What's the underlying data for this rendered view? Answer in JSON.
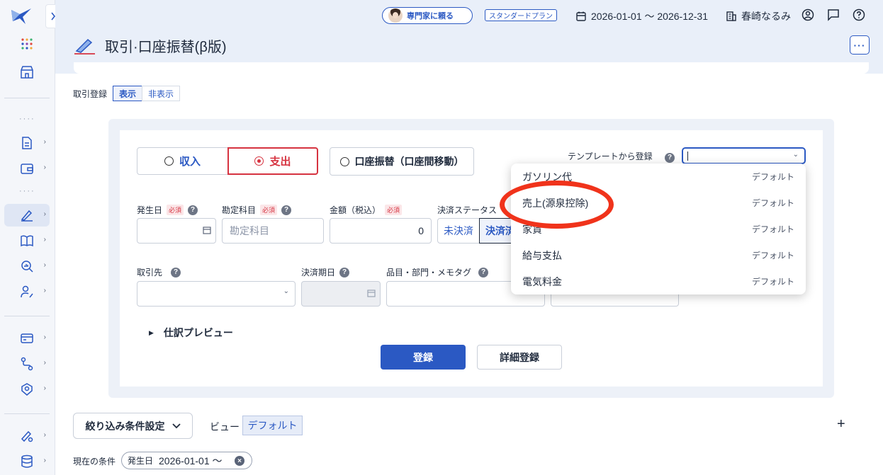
{
  "header": {
    "expert_button": "専門家に頼る",
    "plan": "スタンダードプラン",
    "period": "2026-01-01 〜 2026-12-31",
    "office": "春崎なるみ",
    "page_title": "取引·口座振替(β版)",
    "more": "···"
  },
  "registration": {
    "label": "取引登録",
    "show": "表示",
    "hide": "非表示"
  },
  "form": {
    "type_income": "収入",
    "type_expense": "支出",
    "type_transfer": "口座振替（口座間移動）",
    "template_label": "テンプレートから登録",
    "help": "?",
    "required": "必須",
    "date_label": "発生日",
    "account_label": "勘定科目",
    "account_placeholder": "勘定科目",
    "amount_label": "金額（税込）",
    "amount_value": "0",
    "status_label": "決済ステータス",
    "status_unpaid": "未決済",
    "status_paid": "決済済",
    "partner_label": "取引先",
    "due_label": "決済期日",
    "tags_label": "品目・部門・メモタグ",
    "preview": "仕訳プレビュー",
    "register": "登録",
    "detail_register": "詳細登録"
  },
  "dropdown": {
    "items": [
      {
        "name": "ガソリン代",
        "tag": "デフォルト"
      },
      {
        "name": "売上(源泉控除)",
        "tag": "デフォルト"
      },
      {
        "name": "家賃",
        "tag": "デフォルト"
      },
      {
        "name": "給与支払",
        "tag": "デフォルト"
      },
      {
        "name": "電気料金",
        "tag": "デフォルト"
      }
    ]
  },
  "filter": {
    "button": "絞り込み条件設定",
    "view_label": "ビュー",
    "view_value": "デフォルト",
    "add": "+",
    "current_label": "現在の条件",
    "chip_key": "発生日",
    "chip_value": "2026-01-01 〜"
  },
  "colors": {
    "accent": "#2b59c3",
    "expense": "#d63340",
    "highlight": "#f0331b"
  }
}
